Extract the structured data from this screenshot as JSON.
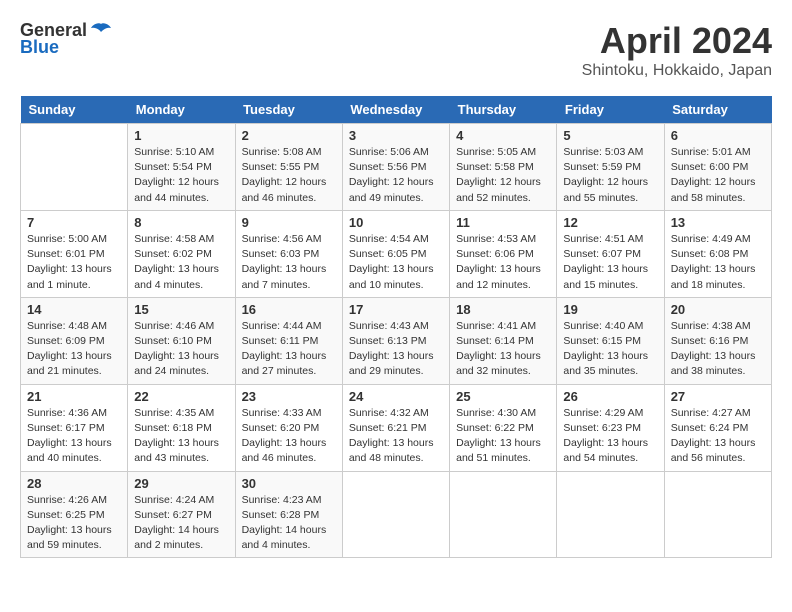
{
  "header": {
    "logo_general": "General",
    "logo_blue": "Blue",
    "title": "April 2024",
    "subtitle": "Shintoku, Hokkaido, Japan"
  },
  "columns": [
    "Sunday",
    "Monday",
    "Tuesday",
    "Wednesday",
    "Thursday",
    "Friday",
    "Saturday"
  ],
  "weeks": [
    [
      {
        "day": "",
        "data": ""
      },
      {
        "day": "1",
        "data": "Sunrise: 5:10 AM\nSunset: 5:54 PM\nDaylight: 12 hours\nand 44 minutes."
      },
      {
        "day": "2",
        "data": "Sunrise: 5:08 AM\nSunset: 5:55 PM\nDaylight: 12 hours\nand 46 minutes."
      },
      {
        "day": "3",
        "data": "Sunrise: 5:06 AM\nSunset: 5:56 PM\nDaylight: 12 hours\nand 49 minutes."
      },
      {
        "day": "4",
        "data": "Sunrise: 5:05 AM\nSunset: 5:58 PM\nDaylight: 12 hours\nand 52 minutes."
      },
      {
        "day": "5",
        "data": "Sunrise: 5:03 AM\nSunset: 5:59 PM\nDaylight: 12 hours\nand 55 minutes."
      },
      {
        "day": "6",
        "data": "Sunrise: 5:01 AM\nSunset: 6:00 PM\nDaylight: 12 hours\nand 58 minutes."
      }
    ],
    [
      {
        "day": "7",
        "data": "Sunrise: 5:00 AM\nSunset: 6:01 PM\nDaylight: 13 hours\nand 1 minute."
      },
      {
        "day": "8",
        "data": "Sunrise: 4:58 AM\nSunset: 6:02 PM\nDaylight: 13 hours\nand 4 minutes."
      },
      {
        "day": "9",
        "data": "Sunrise: 4:56 AM\nSunset: 6:03 PM\nDaylight: 13 hours\nand 7 minutes."
      },
      {
        "day": "10",
        "data": "Sunrise: 4:54 AM\nSunset: 6:05 PM\nDaylight: 13 hours\nand 10 minutes."
      },
      {
        "day": "11",
        "data": "Sunrise: 4:53 AM\nSunset: 6:06 PM\nDaylight: 13 hours\nand 12 minutes."
      },
      {
        "day": "12",
        "data": "Sunrise: 4:51 AM\nSunset: 6:07 PM\nDaylight: 13 hours\nand 15 minutes."
      },
      {
        "day": "13",
        "data": "Sunrise: 4:49 AM\nSunset: 6:08 PM\nDaylight: 13 hours\nand 18 minutes."
      }
    ],
    [
      {
        "day": "14",
        "data": "Sunrise: 4:48 AM\nSunset: 6:09 PM\nDaylight: 13 hours\nand 21 minutes."
      },
      {
        "day": "15",
        "data": "Sunrise: 4:46 AM\nSunset: 6:10 PM\nDaylight: 13 hours\nand 24 minutes."
      },
      {
        "day": "16",
        "data": "Sunrise: 4:44 AM\nSunset: 6:11 PM\nDaylight: 13 hours\nand 27 minutes."
      },
      {
        "day": "17",
        "data": "Sunrise: 4:43 AM\nSunset: 6:13 PM\nDaylight: 13 hours\nand 29 minutes."
      },
      {
        "day": "18",
        "data": "Sunrise: 4:41 AM\nSunset: 6:14 PM\nDaylight: 13 hours\nand 32 minutes."
      },
      {
        "day": "19",
        "data": "Sunrise: 4:40 AM\nSunset: 6:15 PM\nDaylight: 13 hours\nand 35 minutes."
      },
      {
        "day": "20",
        "data": "Sunrise: 4:38 AM\nSunset: 6:16 PM\nDaylight: 13 hours\nand 38 minutes."
      }
    ],
    [
      {
        "day": "21",
        "data": "Sunrise: 4:36 AM\nSunset: 6:17 PM\nDaylight: 13 hours\nand 40 minutes."
      },
      {
        "day": "22",
        "data": "Sunrise: 4:35 AM\nSunset: 6:18 PM\nDaylight: 13 hours\nand 43 minutes."
      },
      {
        "day": "23",
        "data": "Sunrise: 4:33 AM\nSunset: 6:20 PM\nDaylight: 13 hours\nand 46 minutes."
      },
      {
        "day": "24",
        "data": "Sunrise: 4:32 AM\nSunset: 6:21 PM\nDaylight: 13 hours\nand 48 minutes."
      },
      {
        "day": "25",
        "data": "Sunrise: 4:30 AM\nSunset: 6:22 PM\nDaylight: 13 hours\nand 51 minutes."
      },
      {
        "day": "26",
        "data": "Sunrise: 4:29 AM\nSunset: 6:23 PM\nDaylight: 13 hours\nand 54 minutes."
      },
      {
        "day": "27",
        "data": "Sunrise: 4:27 AM\nSunset: 6:24 PM\nDaylight: 13 hours\nand 56 minutes."
      }
    ],
    [
      {
        "day": "28",
        "data": "Sunrise: 4:26 AM\nSunset: 6:25 PM\nDaylight: 13 hours\nand 59 minutes."
      },
      {
        "day": "29",
        "data": "Sunrise: 4:24 AM\nSunset: 6:27 PM\nDaylight: 14 hours\nand 2 minutes."
      },
      {
        "day": "30",
        "data": "Sunrise: 4:23 AM\nSunset: 6:28 PM\nDaylight: 14 hours\nand 4 minutes."
      },
      {
        "day": "",
        "data": ""
      },
      {
        "day": "",
        "data": ""
      },
      {
        "day": "",
        "data": ""
      },
      {
        "day": "",
        "data": ""
      }
    ]
  ]
}
